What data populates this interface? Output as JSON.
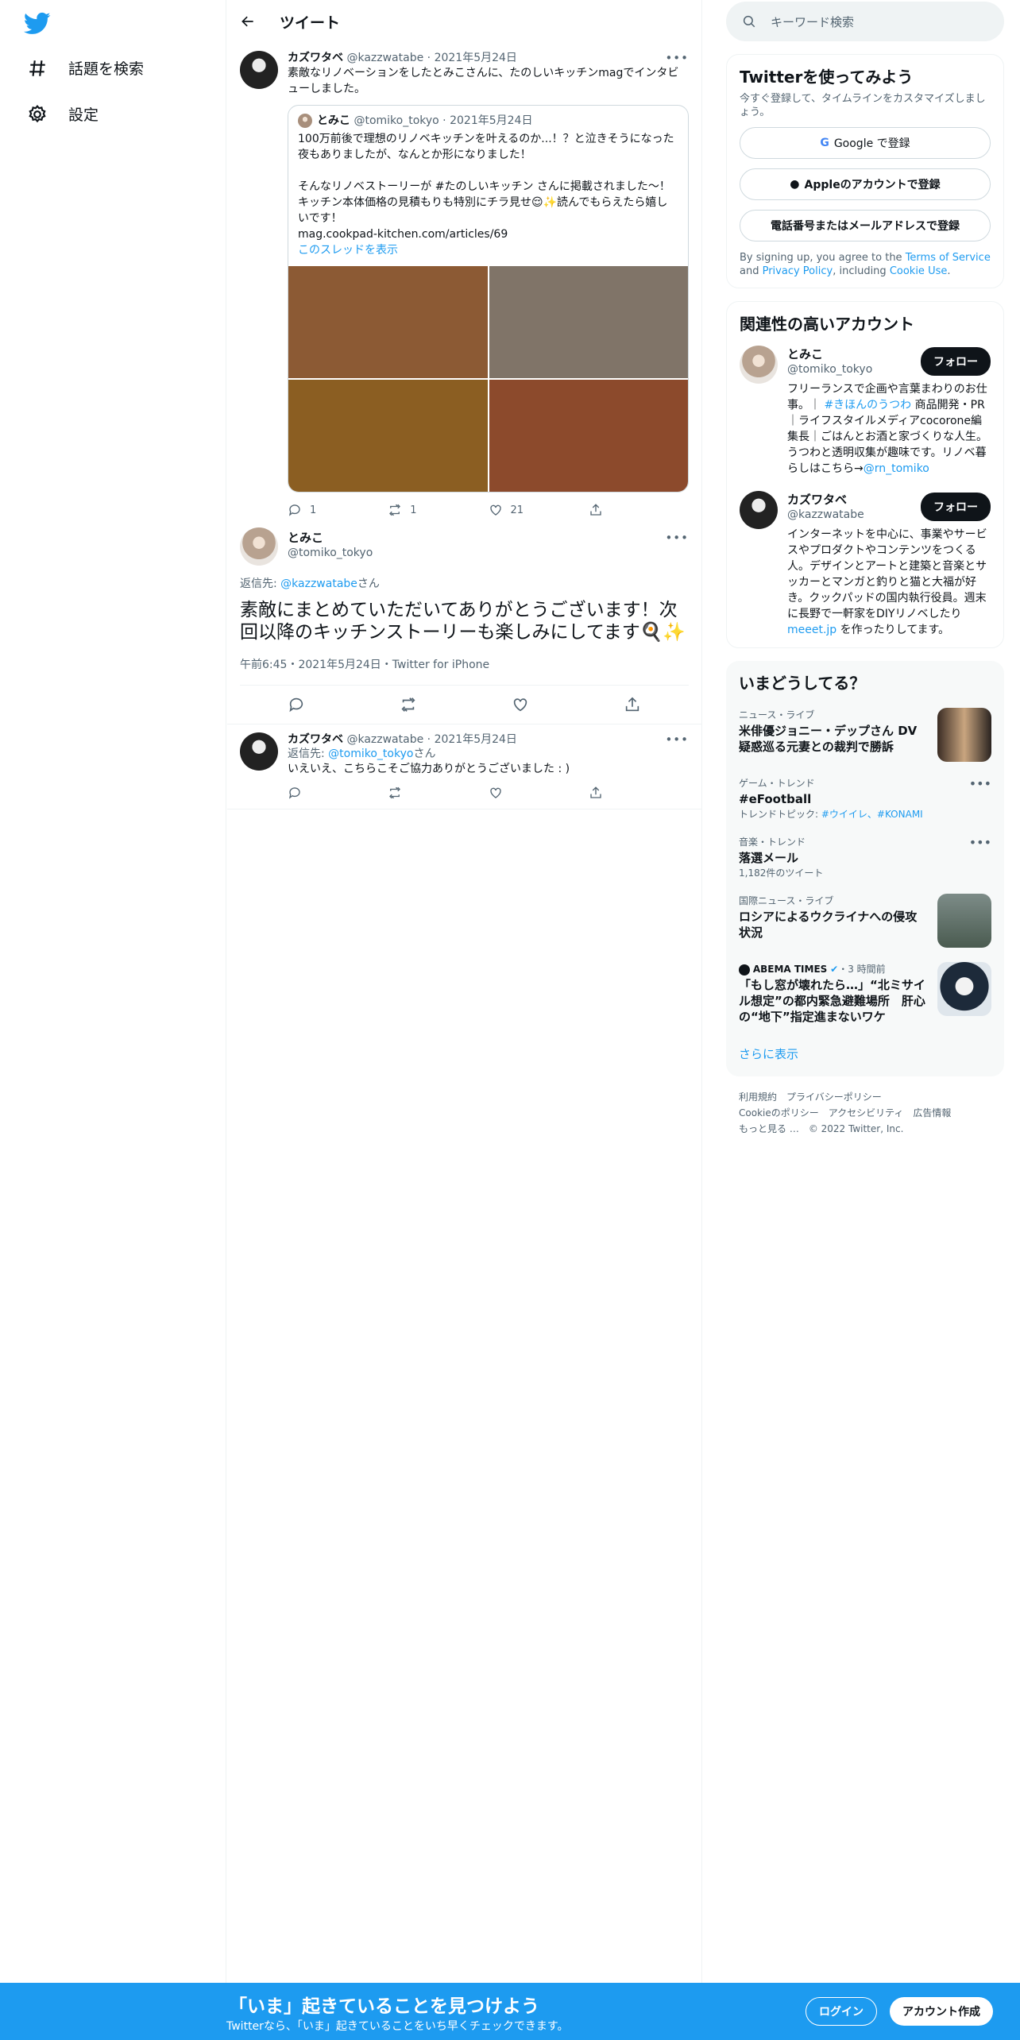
{
  "sidebar": {
    "explore": "話題を検索",
    "settings": "設定"
  },
  "header": {
    "title": "ツイート"
  },
  "tweet1": {
    "name": "カズワタベ",
    "handle": "@kazzwatabe",
    "date": "2021年5月24日",
    "text": "素敵なリノベーションをしたとみこさんに、たのしいキッチンmagでインタビューしました。"
  },
  "quote": {
    "name": "とみこ",
    "handle": "@tomiko_tokyo",
    "date": "2021年5月24日",
    "text1": "100万前後で理想のリノベキッチンを叶えるのか...！？と泣きそうになった夜もありましたが、なんとか形になりました！",
    "text2": "そんなリノベストーリーが #たのしいキッチン さんに掲載されました〜！キッチン本体価格の見積もりも特別にチラ見せ😌✨読んでもらえたら嬉しいです！",
    "url": "mag.cookpad-kitchen.com/articles/69",
    "thread": "このスレッドを表示"
  },
  "images": {
    "colors": [
      "#8c5a34",
      "#807468",
      "#8b5e22",
      "#8c4a2c"
    ]
  },
  "tweet1_actions": {
    "replies": "1",
    "retweets": "1",
    "likes": "21"
  },
  "main": {
    "name": "とみこ",
    "handle": "@tomiko_tokyo",
    "reply_prefix": "返信先: ",
    "reply_to": "@kazzwatabe",
    "reply_suffix": "さん",
    "text": "素敵にまとめていただいてありがとうございます！次回以降のキッチンストーリーも楽しみにしてます🍳✨",
    "timestamp": "午前6:45・2021年5月24日・Twitter for iPhone"
  },
  "reply": {
    "name": "カズワタベ",
    "handle": "@kazzwatabe",
    "date": "2021年5月24日",
    "reply_prefix": "返信先: ",
    "reply_to": "@tomiko_tokyo",
    "reply_suffix": "さん",
    "text": "いえいえ、こちらこそご協力ありがとうございました : )"
  },
  "search": {
    "placeholder": "キーワード検索"
  },
  "signup": {
    "title": "Twitterを使ってみよう",
    "sub": "今すぐ登録して、タイムラインをカスタマイズしましょう。",
    "google": "Google で登録",
    "apple": "Appleのアカウントで登録",
    "phone": "電話番号またはメールアドレスで登録",
    "terms_a": "By signing up, you agree to the ",
    "terms_link": "Terms of Service",
    "terms_b": " and ",
    "privacy": "Privacy Policy",
    "terms_c": ", including ",
    "cookie": "Cookie Use",
    "terms_d": "."
  },
  "related": {
    "title": "関連性の高いアカウント",
    "follow": "フォロー",
    "a1": {
      "name": "とみこ",
      "handle": "@tomiko_tokyo",
      "bio1": "フリーランスで企画や言葉まわりのお仕事。｜ ",
      "tag": "#きほんのうつわ",
      "bio2": " 商品開発・PR｜ライフスタイルメディアcocorone編集長｜ごはんとお酒と家づくりな人生。うつわと透明収集が趣味です。リノベ暮らしはこちら→",
      "link": "@rn_tomiko"
    },
    "a2": {
      "name": "カズワタベ",
      "handle": "@kazzwatabe",
      "bio1": "インターネットを中心に、事業やサービスやプロダクトやコンテンツをつくる人。デザインとアートと建築と音楽とサッカーとマンガと釣りと猫と大福が好き。クックパッドの国内執行役員。週末に長野で一軒家をDIYリノベしたり ",
      "link": "meeet.jp",
      "bio2": " を作ったりしてます。"
    }
  },
  "trends": {
    "title": "いまどうしてる？",
    "more": "さらに表示",
    "t1": {
      "label": "ニュース・ライブ",
      "title": "米俳優ジョニー・デップさん DV疑惑巡る元妻との裁判で勝訴"
    },
    "t2": {
      "label": "ゲーム・トレンド",
      "title": "#eFootball",
      "sub_prefix": "トレンドトピック: ",
      "sub_links": "#ウイイレ、#KONAMI"
    },
    "t3": {
      "label": "音楽・トレンド",
      "title": "落選メール",
      "sub": "1,182件のツイート"
    },
    "t4": {
      "label": "国際ニュース・ライブ",
      "title": "ロシアによるウクライナへの侵攻状況"
    },
    "t5": {
      "source": "ABEMA TIMES",
      "time": "・3 時間前",
      "title": "「もし窓が壊れたら…」“北ミサイル想定”の都内緊急避難場所　肝心の“地下”指定進まないワケ"
    }
  },
  "footer": {
    "l1": "利用規約　プライバシーポリシー",
    "l2": "Cookieのポリシー　アクセシビリティ　広告情報",
    "l3": "もっと見る …　© 2022 Twitter, Inc."
  },
  "banner": {
    "title": "「いま」起きていることを見つけよう",
    "sub": "Twitterなら、「いま」起きていることをいち早くチェックできます。",
    "login": "ログイン",
    "signup": "アカウント作成"
  }
}
